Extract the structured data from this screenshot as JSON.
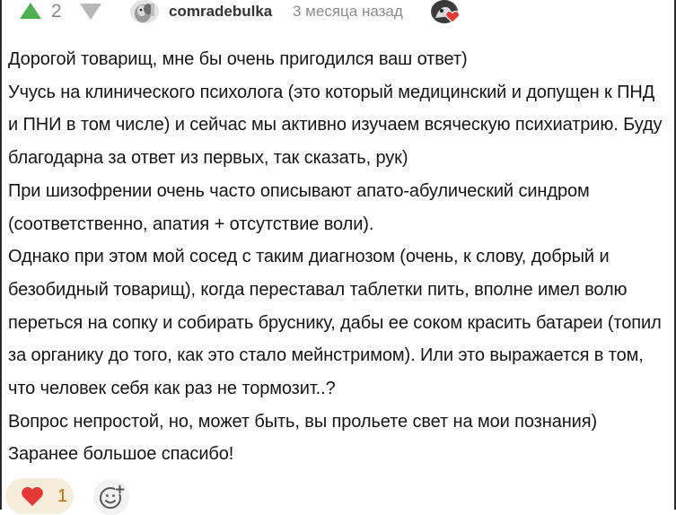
{
  "header": {
    "vote_count": "2",
    "username": "comradebulka",
    "timestamp": "3 месяца назад"
  },
  "comment": {
    "paragraphs": [
      "Дорогой товарищ, мне бы очень пригодился ваш ответ)",
      "Учусь на клинического психолога (это который медицинский и допущен к ПНД и ПНИ в том числе) и сейчас мы активно изучаем всяческую психиатрию. Буду благодарна за ответ из первых, так сказать, рук)",
      "При шизофрении очень часто описывают апато-абулический синдром (соответственно, апатия + отсутствие воли).",
      "Однако при этом мой сосед с таким диагнозом (очень, к слову, добрый и безобидный товарищ), когда переставал таблетки пить, вполне имел волю переться на сопку и собирать бруснику, дабы ее соком красить батареи (топил за органику до того, как это стало мейнстримом). Или это выражается в том, что человек себя как раз не тормозит..?",
      "Вопрос непростой, но, может быть, вы прольете свет на мои познания)",
      "Заранее большое спасибо!"
    ]
  },
  "footer": {
    "like_count": "1"
  },
  "icons": {
    "vote_up": "triangle-up-icon",
    "vote_down": "triangle-down-icon",
    "like": "heart-icon",
    "emoji": "smiley-add-icon"
  },
  "colors": {
    "vote_up": "#4caf50",
    "vote_down": "#b8b8b8",
    "heart": "#e53935",
    "like_bg": "#f6ecdc",
    "like_count": "#c76b00"
  }
}
